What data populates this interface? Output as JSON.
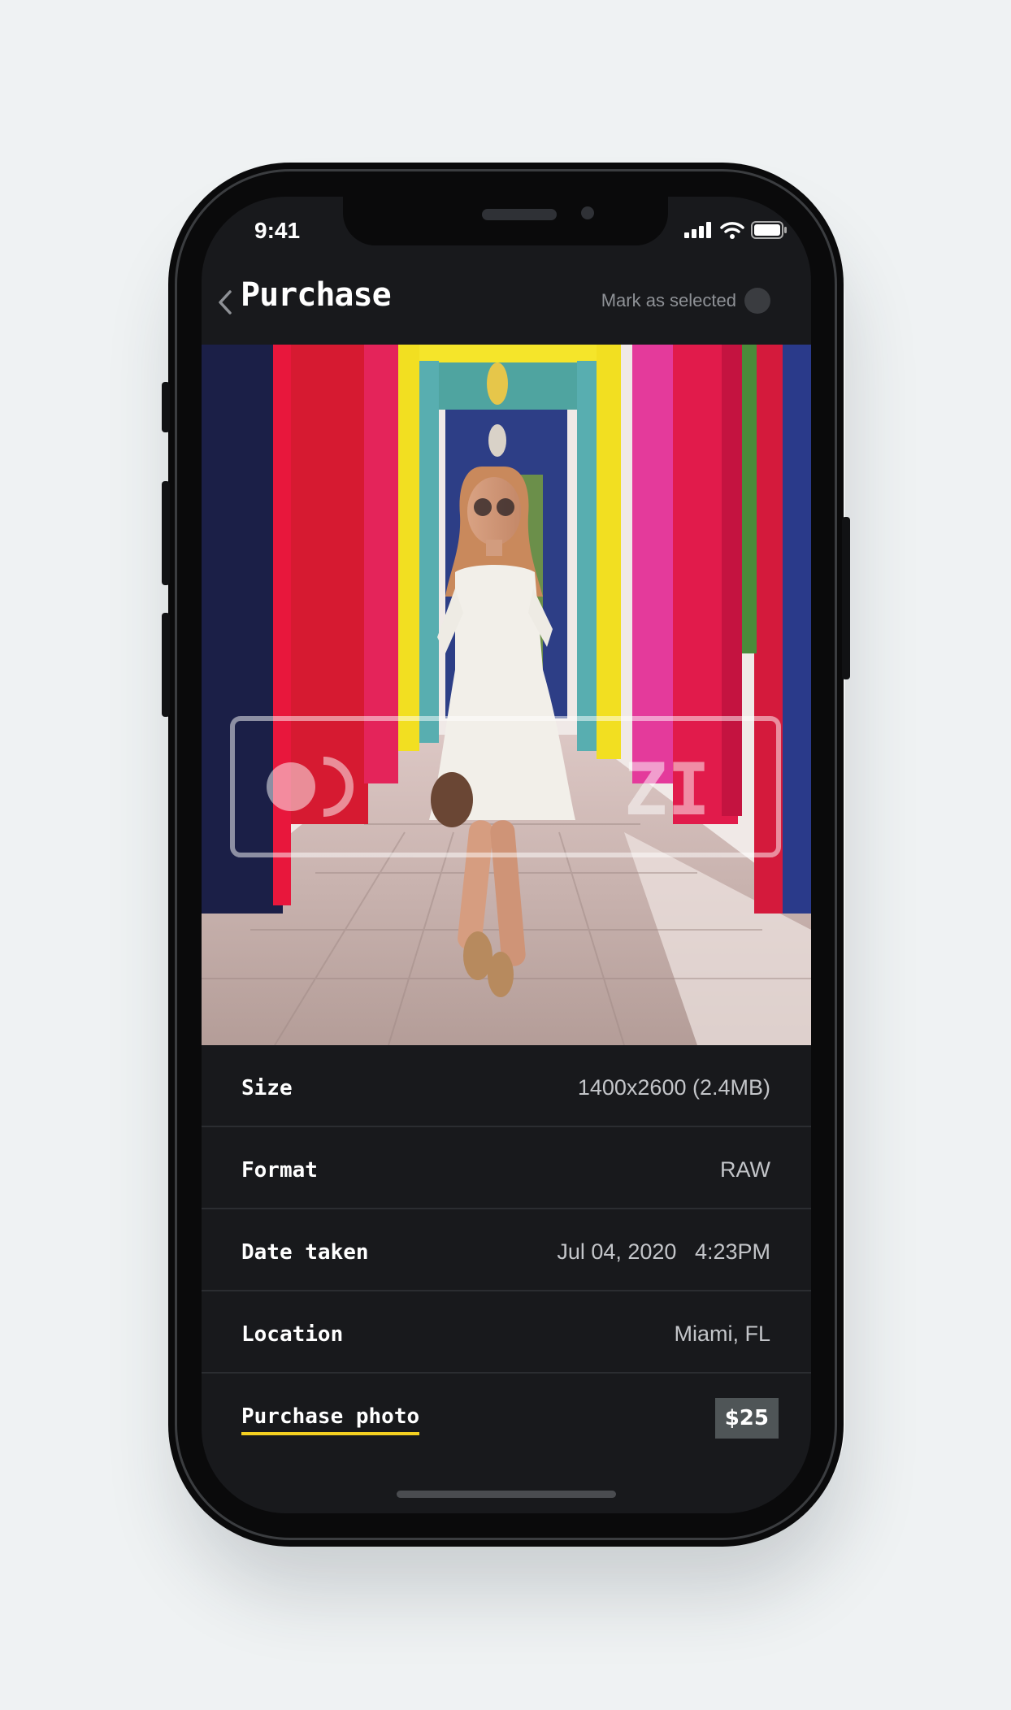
{
  "status_bar": {
    "time": "9:41"
  },
  "header": {
    "title": "Purchase",
    "mark_selected_label": "Mark as selected"
  },
  "details": [
    {
      "label": "Size",
      "value": "1400x2600 (2.4MB)"
    },
    {
      "label": "Format",
      "value": "RAW"
    },
    {
      "label": "Date taken",
      "value": "Jul 04, 2020   4:23PM"
    },
    {
      "label": "Location",
      "value": "Miami, FL"
    }
  ],
  "purchase": {
    "link_label": "Purchase photo",
    "price": "$25"
  },
  "colors": {
    "background": "#eff2f3",
    "screen": "#18191c",
    "accent_underline": "#f4d021",
    "price_badge": "#4f5557"
  },
  "icons": [
    "back-chevron-icon",
    "signal-icon",
    "wifi-icon",
    "battery-icon",
    "watermark-logo"
  ]
}
